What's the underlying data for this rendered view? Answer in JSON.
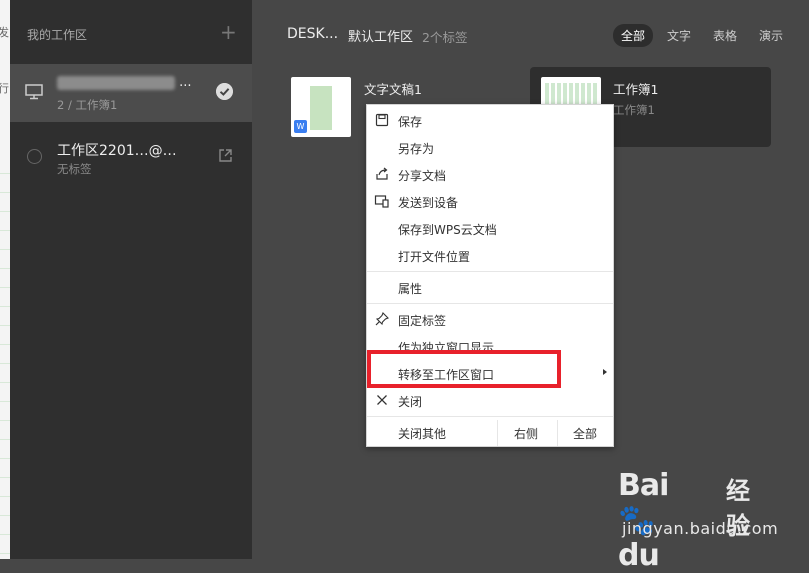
{
  "edge": {
    "chars": [
      "发",
      "行"
    ]
  },
  "sidebar": {
    "title": "我的工作区",
    "add_symbol": "+",
    "workspaces": [
      {
        "name_suffix": "...",
        "sub": "2 / 工作簿1"
      },
      {
        "name": "工作区2201…@…",
        "sub": "无标签"
      }
    ]
  },
  "main": {
    "device": "DESK...",
    "workspace": "默认工作区",
    "tab_count": "2个标签",
    "filters": [
      "全部",
      "文字",
      "表格",
      "演示"
    ],
    "doc1": {
      "title": "文字文稿1",
      "badge": "W"
    },
    "doc2": {
      "title": "工作簿1",
      "sub": "工作簿1"
    }
  },
  "menu": {
    "items": [
      "保存",
      "另存为",
      "分享文档",
      "发送到设备",
      "保存到WPS云文档",
      "打开文件位置",
      "属性",
      "固定标签",
      "作为独立窗口显示",
      "转移至工作区窗口",
      "关闭"
    ],
    "bottom": {
      "close_others": "关闭其他",
      "right": "右侧",
      "all": "全部"
    }
  },
  "watermark": {
    "brand": "Bai",
    "brand2": "du",
    "jy": "经验",
    "url": "jingyan.baidu.com"
  },
  "colors": {
    "highlight": "#e8212b",
    "active_filter_bg": "#2d2d2d"
  }
}
